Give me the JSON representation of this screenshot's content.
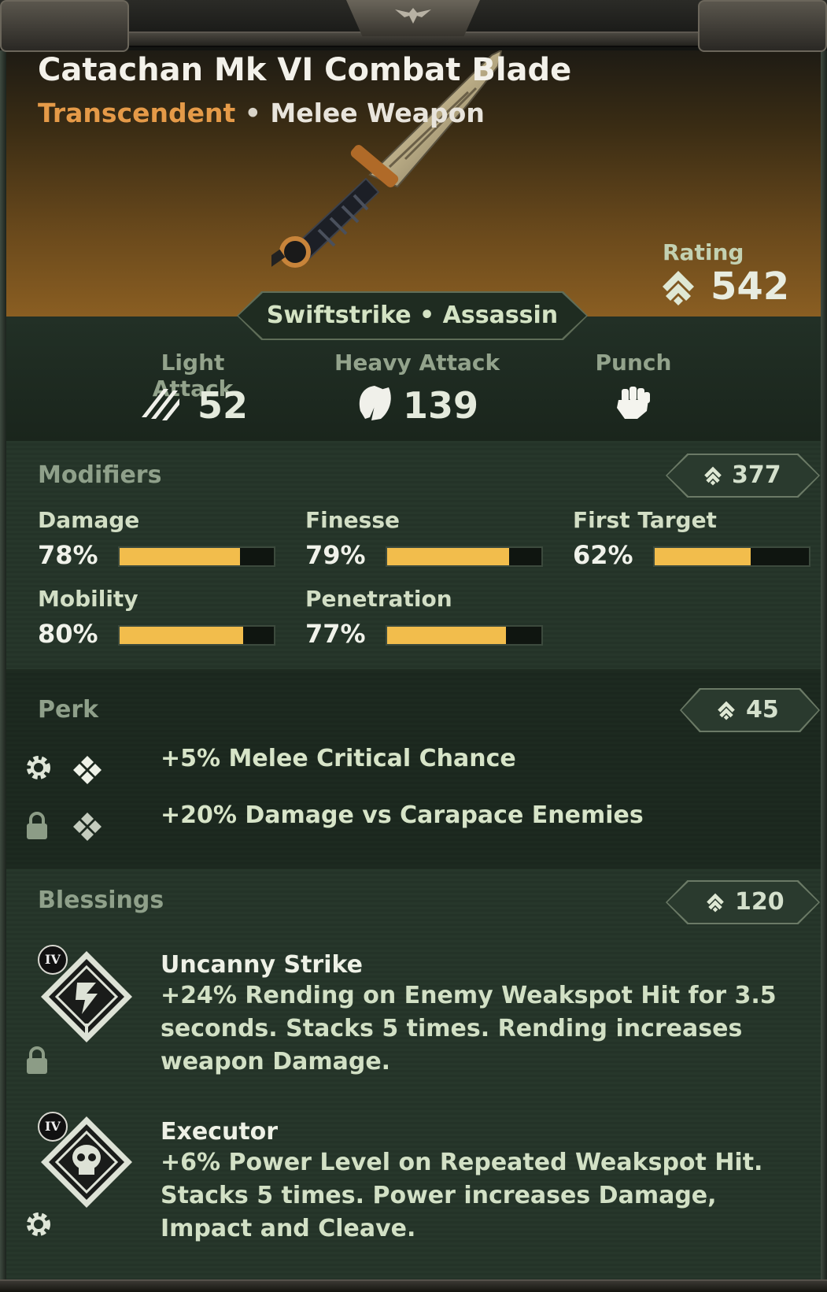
{
  "item": {
    "name": "Catachan Mk VI Combat Blade",
    "rarity": "Transcendent",
    "separator": "•",
    "type": "Melee Weapon",
    "rating_label": "Rating",
    "rating_value": "542",
    "class_tag": "Swiftstrike • Assassin"
  },
  "attacks": [
    {
      "label": "Light Attack",
      "value": "52",
      "icon": "light-attack-icon"
    },
    {
      "label": "Heavy Attack",
      "value": "139",
      "icon": "heavy-attack-icon"
    },
    {
      "label": "Punch",
      "value": "",
      "icon": "fist-icon"
    }
  ],
  "modifiers": {
    "title": "Modifiers",
    "score": "377",
    "stats": [
      {
        "name": "Damage",
        "pct": "78%",
        "fill": 0.78
      },
      {
        "name": "Finesse",
        "pct": "79%",
        "fill": 0.79
      },
      {
        "name": "First Target",
        "pct": "62%",
        "fill": 0.62
      },
      {
        "name": "Mobility",
        "pct": "80%",
        "fill": 0.8
      },
      {
        "name": "Penetration",
        "pct": "77%",
        "fill": 0.77
      }
    ]
  },
  "perk": {
    "title": "Perk",
    "score": "45",
    "items": [
      {
        "text": "+5% Melee Critical Chance",
        "state_icon": "gear-icon"
      },
      {
        "text": "+20% Damage vs Carapace Enemies",
        "state_icon": "lock-icon"
      }
    ]
  },
  "blessings": {
    "title": "Blessings",
    "score": "120",
    "items": [
      {
        "tier": "IV",
        "name": "Uncanny Strike",
        "desc": "+24% Rending on Enemy Weakspot Hit for 3.5 seconds. Stacks 5 times. Rending increases weapon Damage.",
        "state_icon": "lock-icon"
      },
      {
        "tier": "IV",
        "name": "Executor",
        "desc": "+6% Power Level on Repeated Weakspot Hit. Stacks 5 times. Power increases Damage, Impact and Cleave.",
        "state_icon": "gear-icon"
      }
    ]
  },
  "colors": {
    "rarity": "#e59a48",
    "bar_fill": "#f2bd4c",
    "panel": "#243328"
  }
}
